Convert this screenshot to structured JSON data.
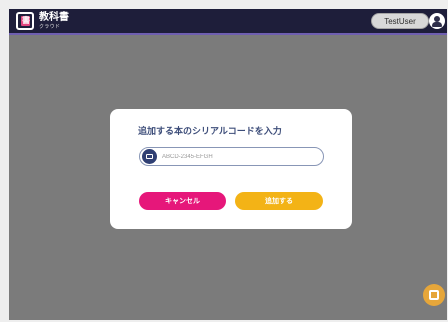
{
  "header": {
    "app_title": "教科書",
    "app_subtitle": "クラウド",
    "user_name": "TestUser"
  },
  "dialog": {
    "title": "追加する本のシリアルコードを入力",
    "serial_placeholder": "ABCD-2345-EFGH",
    "serial_value": "",
    "cancel_label": "キャンセル",
    "add_label": "追加する"
  },
  "icons": {
    "logo": "textbook-logo-icon",
    "user": "user-avatar-icon",
    "serial_field": "book-icon",
    "fab": "add-book-icon"
  },
  "colors": {
    "topbar": "#1e1e3a",
    "overlay": "#7b7b7b",
    "cancel": "#e6177a",
    "add": "#f3b316",
    "title": "#3e4e7a"
  }
}
